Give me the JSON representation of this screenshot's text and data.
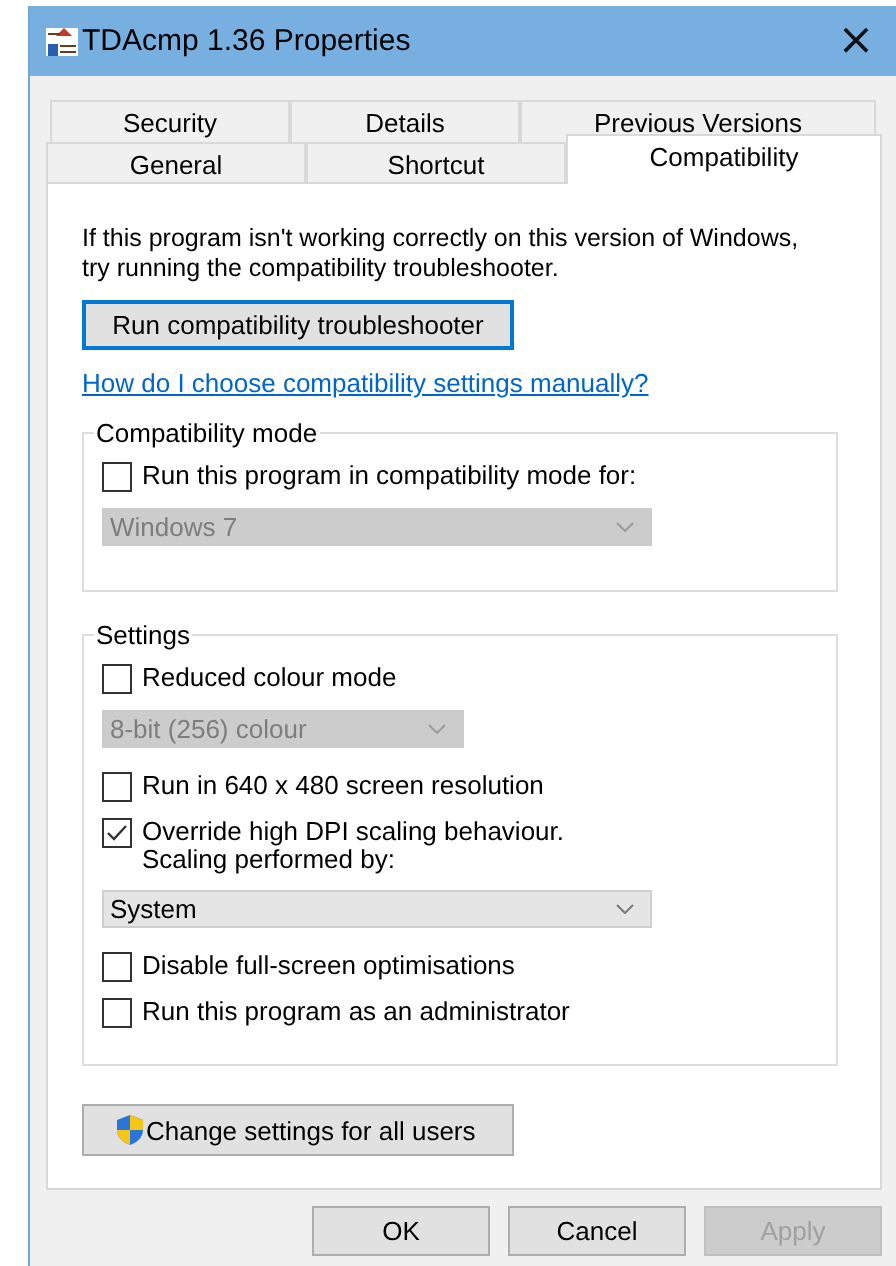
{
  "window": {
    "title": "TDAcmp 1.36 Properties",
    "close": "×"
  },
  "tab_rows": [
    [
      {
        "label": "Security",
        "selected": false
      },
      {
        "label": "Details",
        "selected": false
      },
      {
        "label": "Previous Versions",
        "selected": false
      }
    ],
    [
      {
        "label": "General",
        "selected": false
      },
      {
        "label": "Shortcut",
        "selected": false
      },
      {
        "label": "Compatibility",
        "selected": true
      }
    ]
  ],
  "intro": "If this program isn't working correctly on this version of Windows, try running the compatibility troubleshooter.",
  "troubleshoot_button": "Run compatibility troubleshooter",
  "help_link": "How do I choose compatibility settings manually?",
  "groups": [
    {
      "title": "Compatibility mode",
      "items": [
        {
          "kind": "checkbox",
          "label": "Run this program in compatibility mode for:",
          "checked": false
        },
        {
          "kind": "dropdown",
          "value": "Windows 7",
          "disabled": true,
          "wide": true
        }
      ]
    },
    {
      "title": "Settings",
      "items": [
        {
          "kind": "checkbox",
          "label": "Reduced colour mode",
          "checked": false
        },
        {
          "kind": "dropdown",
          "value": "8-bit (256) colour",
          "disabled": true,
          "wide": false
        },
        {
          "kind": "checkbox",
          "label": "Run in 640 x 480 screen resolution",
          "checked": false
        },
        {
          "kind": "checkbox",
          "label": "Override high DPI scaling behaviour.\nScaling performed by:",
          "checked": true
        },
        {
          "kind": "dropdown",
          "value": "System",
          "disabled": false,
          "wide": true
        },
        {
          "kind": "checkbox",
          "label": "Disable full-screen optimisations",
          "checked": false
        },
        {
          "kind": "checkbox",
          "label": "Run this program as an administrator",
          "checked": false
        }
      ]
    }
  ],
  "all_users_button": "Change settings for all users",
  "buttons": [
    {
      "label": "OK",
      "disabled": false
    },
    {
      "label": "Cancel",
      "disabled": false
    },
    {
      "label": "Apply",
      "disabled": true
    }
  ]
}
